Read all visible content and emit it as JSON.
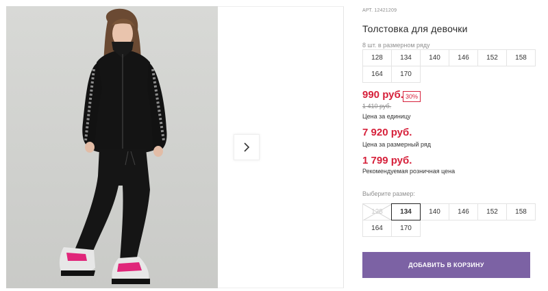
{
  "product": {
    "article": "АРТ. 12421209",
    "title": "Толстовка для девочки"
  },
  "size_row": {
    "label": "8 шт. в размерном ряду",
    "sizes": [
      "128",
      "134",
      "140",
      "146",
      "152",
      "158",
      "164",
      "170"
    ]
  },
  "pricing": {
    "price": "990 руб.",
    "discount": "30%",
    "old_price": "1 410 руб.",
    "unit_caption": "Цена за единицу",
    "row_price": "7 920 руб.",
    "row_caption": "Цена за размерный ряд",
    "rrp_price": "1 799 руб.",
    "rrp_caption": "Рекомендуемая розничная цена"
  },
  "size_select": {
    "label": "Выберите размер:",
    "sizes": [
      "128",
      "134",
      "140",
      "146",
      "152",
      "158",
      "164",
      "170"
    ],
    "selected": "134",
    "unavailable": [
      "128"
    ]
  },
  "actions": {
    "add_to_cart": "ДОБАВИТЬ В КОРЗИНУ"
  },
  "gallery": {
    "next_icon": "chevron-right-icon"
  },
  "colors": {
    "accent_button": "#7c62a4",
    "price_red": "#d6203a"
  }
}
